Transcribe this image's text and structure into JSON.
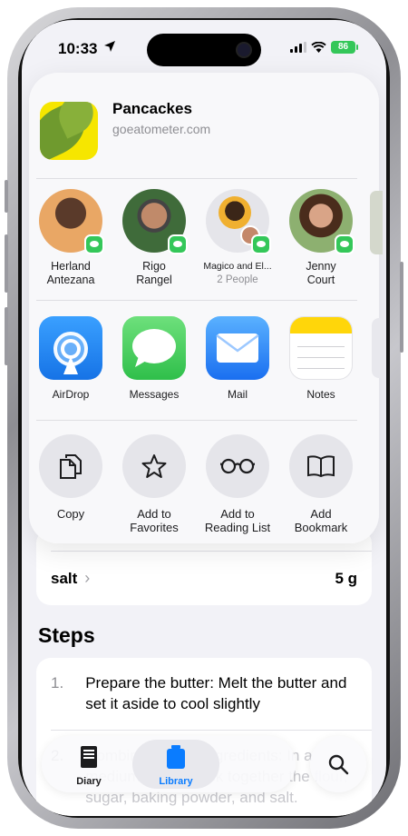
{
  "status_bar": {
    "time": "10:33",
    "battery": "86"
  },
  "share_sheet": {
    "item_title": "Pancackes",
    "item_subtitle": "goeatometer.com",
    "people": [
      {
        "name_line1": "Herland",
        "name_line2": "Antezana",
        "sub": ""
      },
      {
        "name_line1": "Rigo",
        "name_line2": "Rangel",
        "sub": ""
      },
      {
        "name_line1": "Magico and El...",
        "name_line2": "",
        "sub": "2 People"
      },
      {
        "name_line1": "Jenny",
        "name_line2": "Court",
        "sub": ""
      }
    ],
    "apps": [
      {
        "label": "AirDrop",
        "icon": "airdrop-icon"
      },
      {
        "label": "Messages",
        "icon": "messages-icon"
      },
      {
        "label": "Mail",
        "icon": "mail-icon"
      },
      {
        "label": "Notes",
        "icon": "notes-icon"
      }
    ],
    "actions": [
      {
        "line1": "Copy",
        "line2": "",
        "icon": "copy-icon"
      },
      {
        "line1": "Add to",
        "line2": "Favorites",
        "icon": "star-icon"
      },
      {
        "line1": "Add to",
        "line2": "Reading List",
        "icon": "glasses-icon"
      },
      {
        "line1": "Add",
        "line2": "Bookmark",
        "icon": "book-icon"
      }
    ]
  },
  "ingredients": {
    "last": {
      "name": "salt",
      "amount": "5 g"
    }
  },
  "steps": {
    "title": "Steps",
    "items": [
      {
        "num": "1.",
        "text": "Prepare the butter: Melt the butter and set it aside to cool slightly"
      },
      {
        "num": "2.",
        "text": "Combine the dry ingredients: In a medium bowl, whisk together the flour, sugar, baking powder, and salt."
      }
    ]
  },
  "tabbar": {
    "tabs": [
      {
        "label": "Diary",
        "icon": "diary-icon",
        "active": false
      },
      {
        "label": "Library",
        "icon": "library-icon",
        "active": true
      }
    ],
    "search": {
      "icon": "search-icon"
    }
  },
  "colors": {
    "accent": "#0a7cff",
    "messages_green": "#34c759",
    "notes_yellow": "#ffd60a"
  }
}
